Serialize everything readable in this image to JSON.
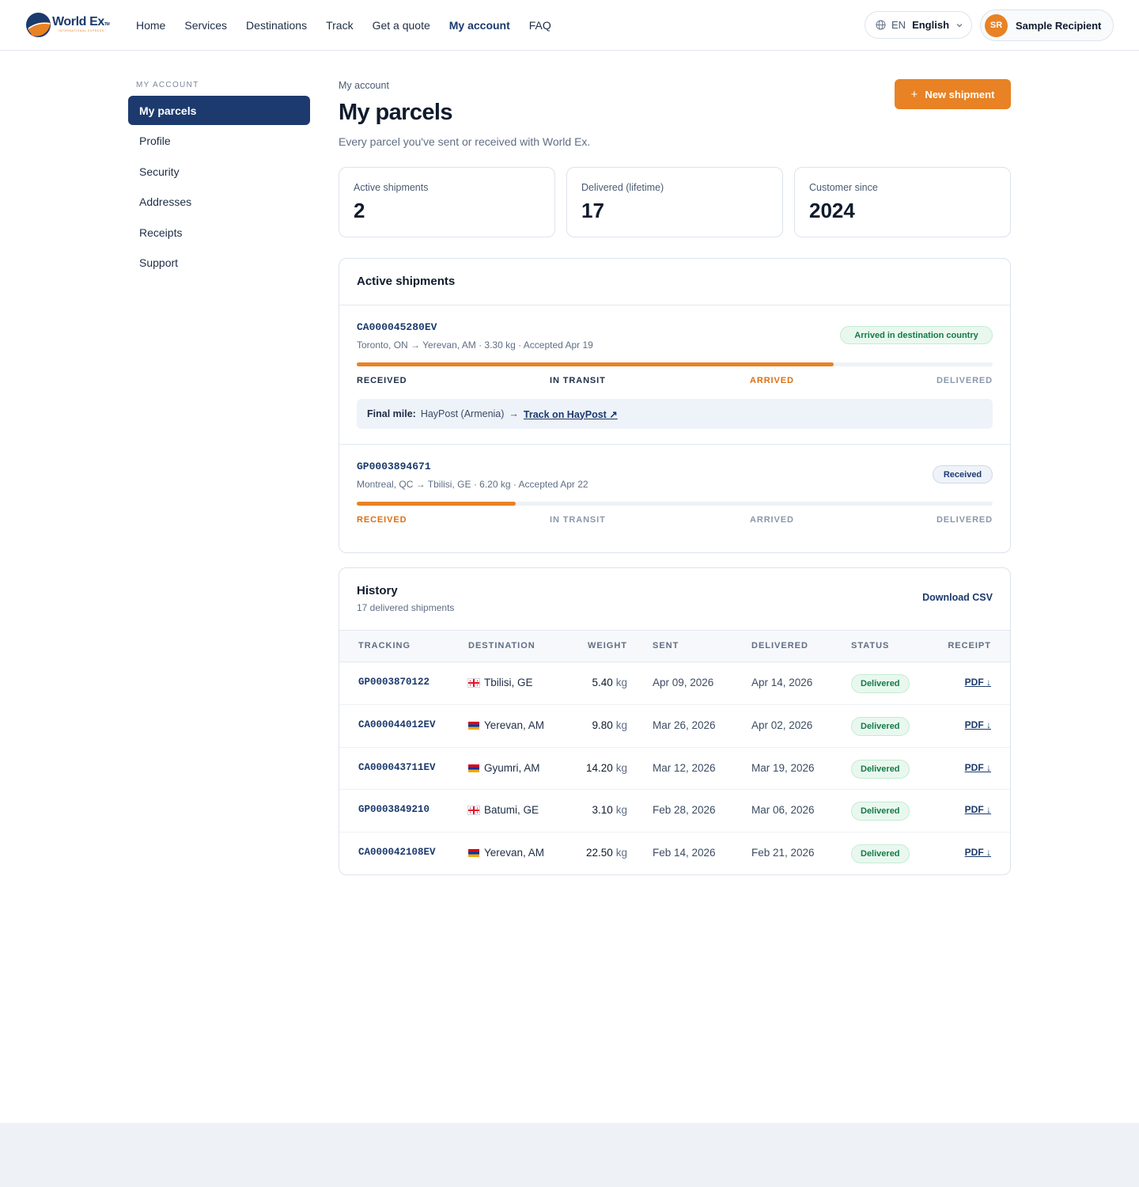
{
  "brand": {
    "name": "World Ex",
    "tm": "TM",
    "tagline": "INTERNATIONAL EXPRESS"
  },
  "nav": [
    {
      "label": "Home"
    },
    {
      "label": "Services"
    },
    {
      "label": "Destinations"
    },
    {
      "label": "Track"
    },
    {
      "label": "Get a quote"
    },
    {
      "label": "My account",
      "active": true
    },
    {
      "label": "FAQ"
    }
  ],
  "language": {
    "code": "EN",
    "name": "English"
  },
  "user": {
    "initials": "SR",
    "name": "Sample Recipient"
  },
  "sidebar": {
    "label": "MY ACCOUNT",
    "items": [
      {
        "label": "My parcels",
        "active": true
      },
      {
        "label": "Profile"
      },
      {
        "label": "Security"
      },
      {
        "label": "Addresses"
      },
      {
        "label": "Receipts"
      },
      {
        "label": "Support"
      }
    ]
  },
  "page": {
    "breadcrumb": "My account",
    "title": "My parcels",
    "subtitle": "Every parcel you've sent or received with World Ex.",
    "new_shipment_label": "New shipment"
  },
  "stats": [
    {
      "label": "Active shipments",
      "value": "2"
    },
    {
      "label": "Delivered (lifetime)",
      "value": "17"
    },
    {
      "label": "Customer since",
      "value": "2024"
    }
  ],
  "active_shipments": {
    "title": "Active shipments",
    "steps": [
      "RECEIVED",
      "IN TRANSIT",
      "ARRIVED",
      "DELIVERED"
    ],
    "items": [
      {
        "tracking": "CA000045280EV",
        "route": "Toronto, ON → Yerevan, AM · 3.30 kg · Accepted Apr 19",
        "status": "Arrived in destination country",
        "status_color": "green",
        "progress": 0.75,
        "current_step": 2,
        "final_mile": {
          "label": "Final mile:",
          "carrier": "HayPost (Armenia)",
          "link": "Track on HayPost ↗"
        }
      },
      {
        "tracking": "GP0003894671",
        "route": "Montreal, QC → Tbilisi, GE · 6.20 kg · Accepted Apr 22",
        "status": "Received",
        "status_color": "blue",
        "progress": 0.25,
        "current_step": 0
      }
    ]
  },
  "history": {
    "title": "History",
    "subtitle": "17 delivered shipments",
    "download_label": "Download CSV",
    "columns": [
      "TRACKING",
      "DESTINATION",
      "WEIGHT",
      "SENT",
      "DELIVERED",
      "STATUS",
      "RECEIPT"
    ],
    "rows": [
      {
        "tracking": "GP0003870122",
        "flag": "georgia",
        "destination": "Tbilisi, GE",
        "weight": "5.40",
        "unit": "kg",
        "sent": "Apr 09, 2026",
        "delivered": "Apr 14, 2026",
        "status": "Delivered",
        "receipt": "PDF ↓"
      },
      {
        "tracking": "CA000044012EV",
        "flag": "armenia",
        "destination": "Yerevan, AM",
        "weight": "9.80",
        "unit": "kg",
        "sent": "Mar 26, 2026",
        "delivered": "Apr 02, 2026",
        "status": "Delivered",
        "receipt": "PDF ↓"
      },
      {
        "tracking": "CA000043711EV",
        "flag": "armenia",
        "destination": "Gyumri, AM",
        "weight": "14.20",
        "unit": "kg",
        "sent": "Mar 12, 2026",
        "delivered": "Mar 19, 2026",
        "status": "Delivered",
        "receipt": "PDF ↓"
      },
      {
        "tracking": "GP0003849210",
        "flag": "georgia",
        "destination": "Batumi, GE",
        "weight": "3.10",
        "unit": "kg",
        "sent": "Feb 28, 2026",
        "delivered": "Mar 06, 2026",
        "status": "Delivered",
        "receipt": "PDF ↓"
      },
      {
        "tracking": "CA000042108EV",
        "flag": "armenia",
        "destination": "Yerevan, AM",
        "weight": "22.50",
        "unit": "kg",
        "sent": "Feb 14, 2026",
        "delivered": "Feb 21, 2026",
        "status": "Delivered",
        "receipt": "PDF ↓"
      }
    ]
  },
  "colors": {
    "primary": "#1d3a6e",
    "accent": "#e88224",
    "success": "#137a45"
  }
}
